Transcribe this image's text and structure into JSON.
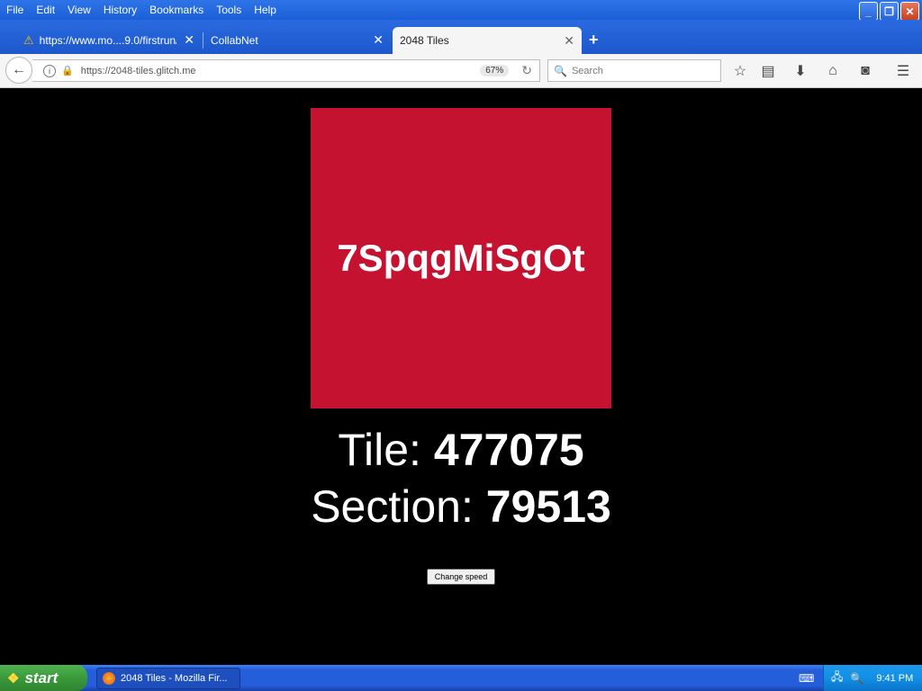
{
  "menubar": {
    "items": [
      "File",
      "Edit",
      "View",
      "History",
      "Bookmarks",
      "Tools",
      "Help"
    ]
  },
  "tabs": [
    {
      "label": "https://www.mo....9.0/firstrun/",
      "icon": "warning-icon",
      "active": false
    },
    {
      "label": "CollabNet",
      "icon": null,
      "active": false
    },
    {
      "label": "2048 Tiles",
      "icon": null,
      "active": true
    }
  ],
  "navbar": {
    "url": "https://2048-tiles.glitch.me",
    "zoom": "67%",
    "search_placeholder": "Search"
  },
  "page": {
    "tile_code": "7SpqgMiSgOt",
    "tile_color": "#c41230",
    "tile_label": "Tile:",
    "tile_value": "477075",
    "section_label": "Section:",
    "section_value": "79513",
    "speed_button": "Change speed"
  },
  "taskbar": {
    "start_label": "start",
    "task_label": "2048 Tiles - Mozilla Fir...",
    "clock": "9:41 PM"
  }
}
